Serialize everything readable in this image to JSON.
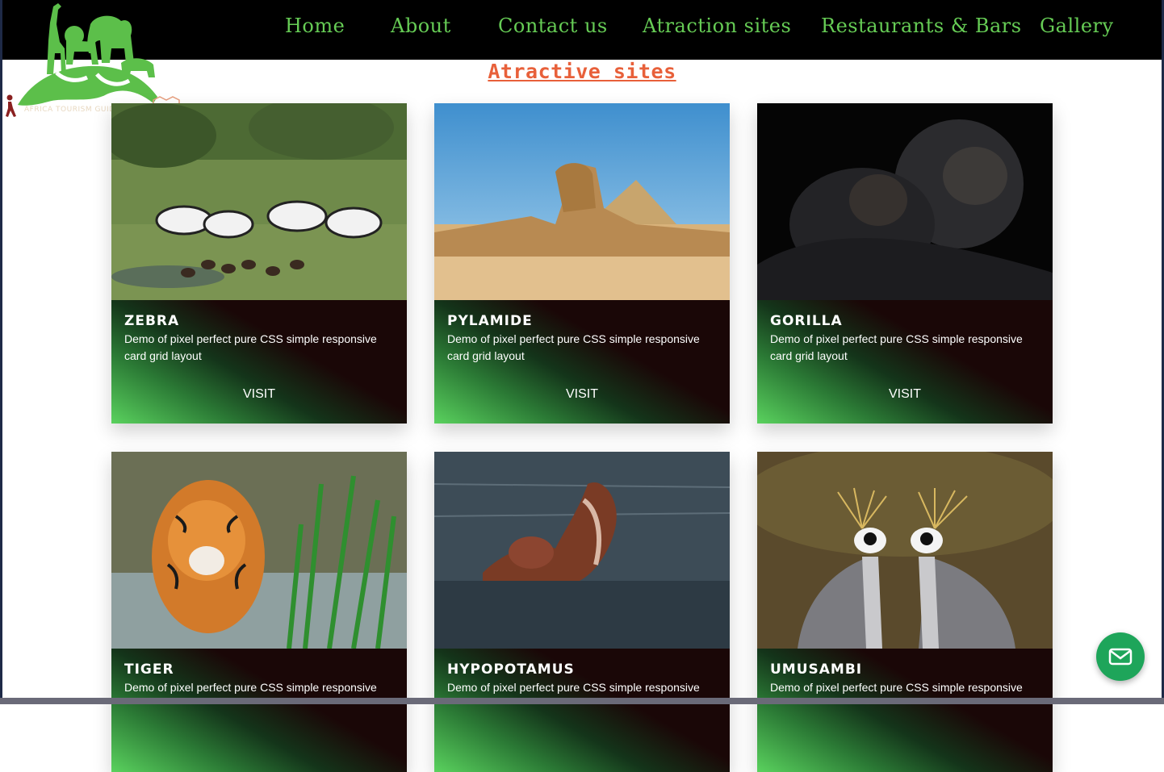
{
  "nav": {
    "items": [
      "Home",
      "About",
      "Contact us",
      "Atraction sites",
      "Restaurants & Bars",
      "Gallery"
    ]
  },
  "logo": {
    "tagline": "AFRICA TOURISM GUIDE"
  },
  "page": {
    "title": "Atractive sites"
  },
  "cards": [
    {
      "name": "ZEBRA",
      "description": "Demo of pixel perfect pure CSS simple responsive card grid layout",
      "action": "VISIT",
      "image": "zebra-herd-photo"
    },
    {
      "name": "PYLAMIDE",
      "description": "Demo of pixel perfect pure CSS simple responsive card grid layout",
      "action": "VISIT",
      "image": "sphinx-pyramid-photo"
    },
    {
      "name": "GORILLA",
      "description": "Demo of pixel perfect pure CSS simple responsive card grid layout",
      "action": "VISIT",
      "image": "gorilla-family-photo"
    },
    {
      "name": "TIGER",
      "description": "Demo of pixel perfect pure CSS simple responsive",
      "image": "tiger-photo"
    },
    {
      "name": "HYPOPOTAMUS",
      "description": "Demo of pixel perfect pure CSS simple responsive",
      "image": "hippopotamus-photo"
    },
    {
      "name": "UMUSAMBI",
      "description": "Demo of pixel perfect pure CSS simple responsive",
      "image": "crowned-crane-photo"
    }
  ],
  "colors": {
    "nav_background": "#000000",
    "nav_link": "#66cc55",
    "title": "#e8603a",
    "card_gradient_green": "#5ad25e",
    "card_dark": "#1a0707",
    "mail_button": "#1ea55a"
  },
  "icons": {
    "mail": "mail-icon",
    "logo": "safari-animals-logo"
  }
}
